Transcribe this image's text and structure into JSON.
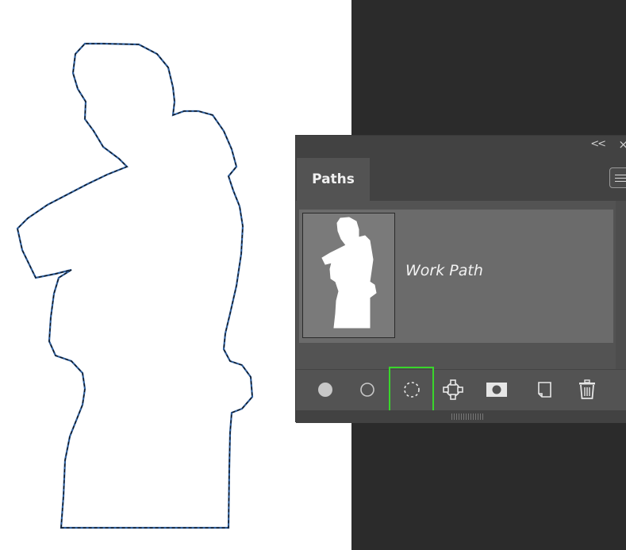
{
  "panel": {
    "tab_label": "Paths",
    "collapse_label": "<<",
    "close_label": "×"
  },
  "paths": [
    {
      "name": "Work Path"
    }
  ],
  "toolbar": {
    "buttons": [
      {
        "name": "fill-path",
        "icon": "filled-circle-icon"
      },
      {
        "name": "stroke-path",
        "icon": "hollow-circle-icon"
      },
      {
        "name": "load-path-as-selection",
        "icon": "dashed-selection-icon",
        "selected": true
      },
      {
        "name": "make-work-path",
        "icon": "anchor-path-icon"
      },
      {
        "name": "add-mask",
        "icon": "mask-icon"
      },
      {
        "name": "create-new-path",
        "icon": "new-path-icon"
      },
      {
        "name": "delete-path",
        "icon": "trash-icon"
      }
    ]
  },
  "colors": {
    "selection_highlight": "#39d62b",
    "path_outline": "#2e5f9e",
    "panel_bg": "#535353",
    "panel_header": "#424242",
    "dark_canvas": "#2b2b2b"
  }
}
